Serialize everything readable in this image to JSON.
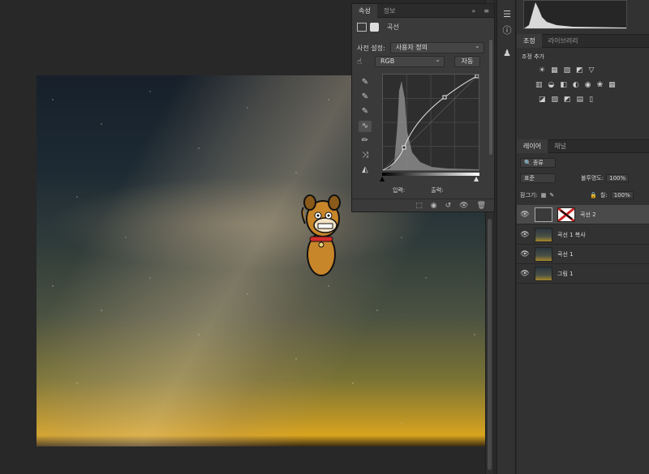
{
  "properties_panel": {
    "tabs": [
      "속성",
      "정보"
    ],
    "title": "곡선",
    "preset_label": "사전 설정:",
    "preset_value": "사용자 정의",
    "channel_value": "RGB",
    "auto_button": "자동",
    "input_label": "입력:",
    "output_label": "출력:"
  },
  "adjustments_panel": {
    "tabs": [
      "조정",
      "라이브러리"
    ],
    "add_label": "조정 추가"
  },
  "layers_panel": {
    "tabs": [
      "레이어",
      "채널"
    ],
    "filter_value": "종류",
    "blend_mode": "표준",
    "opacity_label": "불투명도:",
    "opacity_value": "100%",
    "lock_label": "잠그기:",
    "fill_label": "칠:",
    "fill_value": "100%",
    "layers": [
      {
        "name": "곡선 2",
        "selected": true
      },
      {
        "name": "곡선 1 복사",
        "selected": false
      },
      {
        "name": "곡선 1",
        "selected": false
      },
      {
        "name": "그림 1",
        "selected": false
      }
    ]
  },
  "colors": {
    "panel_bg": "#3a3a3a",
    "app_bg": "#282828",
    "accent_yellow": "#d9a41e"
  }
}
